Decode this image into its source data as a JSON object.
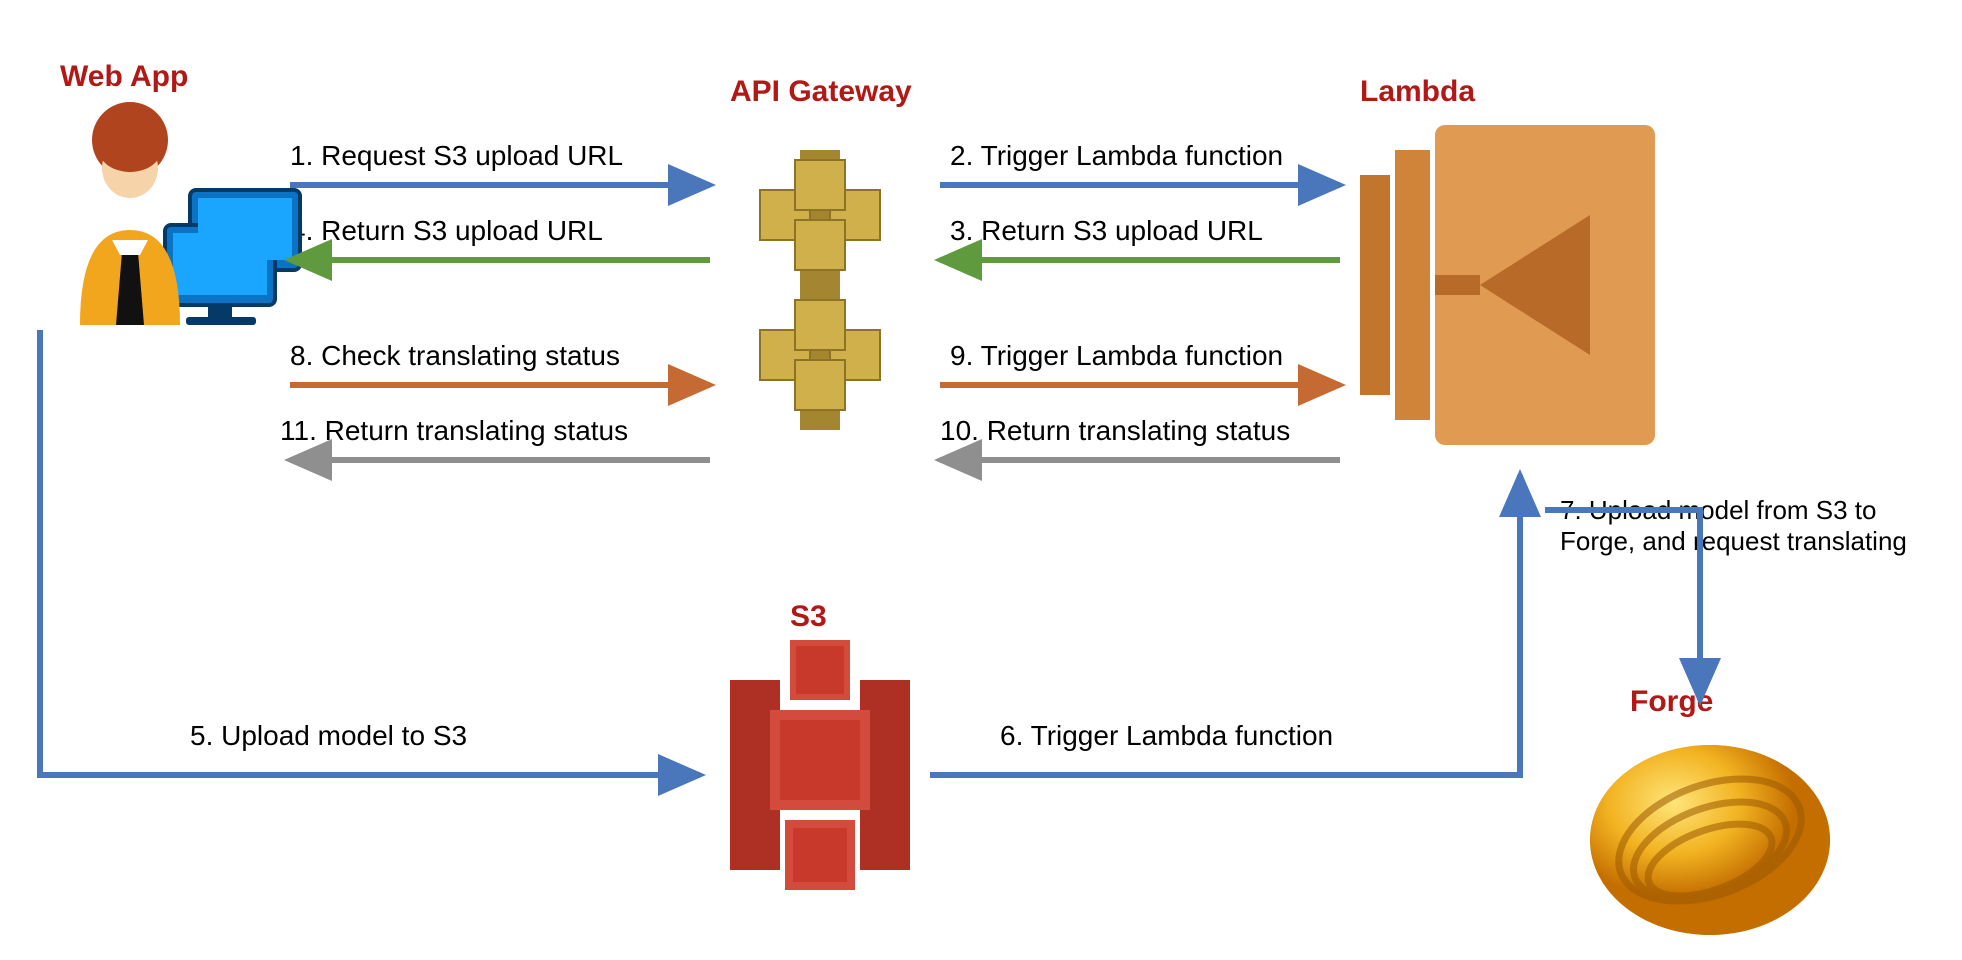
{
  "nodes": {
    "webapp": {
      "title": "Web App"
    },
    "gateway": {
      "title": "API Gateway"
    },
    "lambda": {
      "title": "Lambda"
    },
    "s3": {
      "title": "S3"
    },
    "forge": {
      "title": "Forge"
    }
  },
  "arrows": {
    "a1": {
      "text": "1. Request S3 upload URL"
    },
    "a2": {
      "text": "2. Trigger Lambda function"
    },
    "a3": {
      "text": "3. Return S3 upload URL"
    },
    "a4": {
      "text": "4. Return S3 upload URL"
    },
    "a5": {
      "text": "5. Upload model to S3"
    },
    "a6": {
      "text": "6. Trigger Lambda function"
    },
    "a7": {
      "text": "7. Upload model from S3 to Forge, and request translating"
    },
    "a8": {
      "text": "8. Check translating status"
    },
    "a9": {
      "text": "9. Trigger Lambda function"
    },
    "a10": {
      "text": "10. Return translating status"
    },
    "a11": {
      "text": "11. Return translating status"
    }
  },
  "colors": {
    "blue": "#4a77bb",
    "green": "#5f9b3e",
    "orange": "#c56a32",
    "gray": "#8f8f8f",
    "title": "#b01916",
    "s3": "#c8392b",
    "gw": "#bfa03a",
    "lambda": "#d88a3c",
    "forge": "#e2a514"
  }
}
